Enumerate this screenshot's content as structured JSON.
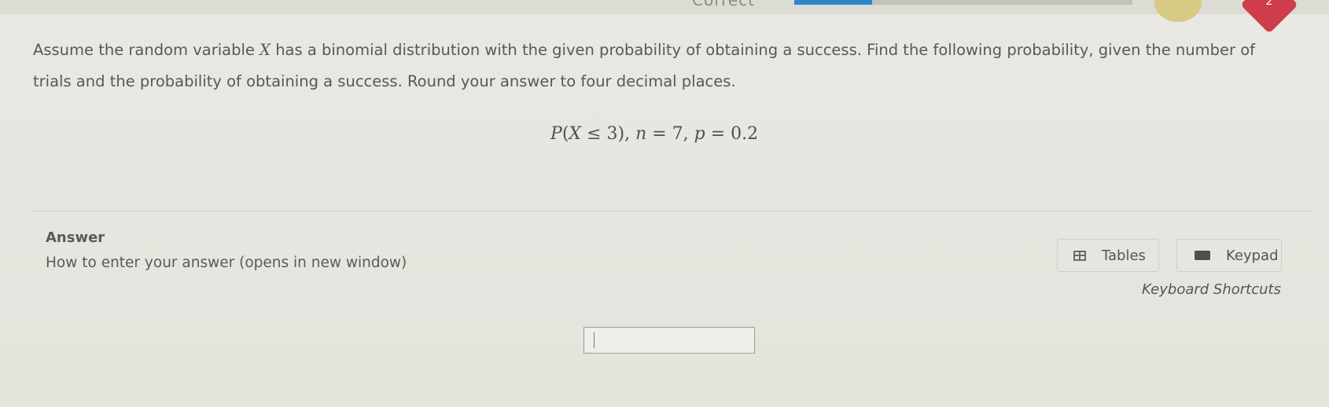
{
  "header": {
    "status_word": "Correct",
    "progress_fraction": 0.23,
    "heart_count": "2"
  },
  "question": {
    "text_before_var": "Assume the random variable ",
    "var": "X",
    "text_after_var": " has a binomial distribution with the given probability of obtaining a success. Find the following probability, given the number of trials and the probability of obtaining a success. Round your answer to four decimal places.",
    "formula": {
      "P": "P",
      "open": "(",
      "X": "X",
      "leq": " ≤ 3),  ",
      "n": "n",
      "n_eq": " = 7,  ",
      "p": "p",
      "p_eq": " = 0.2"
    }
  },
  "answer": {
    "label": "Answer",
    "how_to_link": "How to enter your answer (opens in new window)",
    "tables_label": "Tables",
    "keypad_label": "Keypad",
    "shortcuts_label": "Keyboard Shortcuts",
    "input_value": ""
  },
  "icons": {
    "tables": "table-icon",
    "keypad": "keypad-icon"
  },
  "colors": {
    "progress": "#2f86c9",
    "heart": "#cf3c4a",
    "streak": "#d8ca84"
  }
}
